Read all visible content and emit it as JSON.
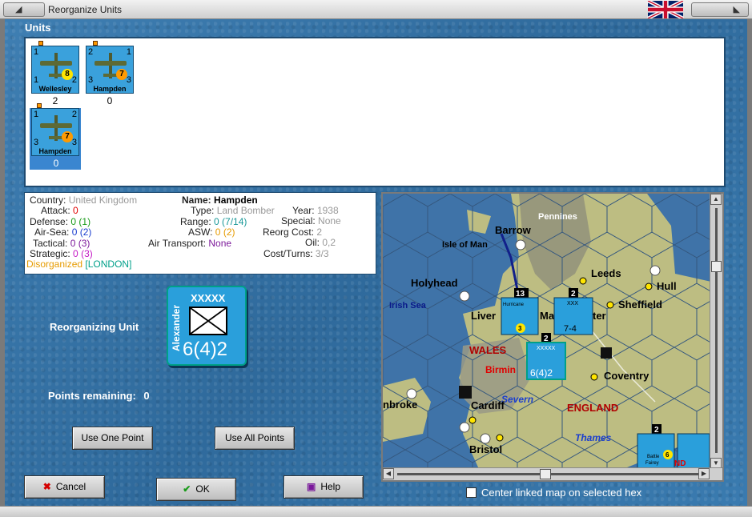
{
  "window": {
    "title": "Reorganize Units"
  },
  "units": {
    "label": "Units",
    "items": [
      {
        "name": "Wellesley",
        "tl": "1",
        "tr": "",
        "bl": "1",
        "br": "2",
        "badge": "8",
        "badge_color": "yellow",
        "count": "2",
        "selected": false
      },
      {
        "name": "Hampden",
        "tl": "2",
        "tr": "1",
        "bl": "3",
        "br": "3",
        "badge": "7",
        "badge_color": "orange",
        "count": "0",
        "selected": false
      },
      {
        "name": "Hampden",
        "tl": "1",
        "tr": "2",
        "bl": "3",
        "br": "3",
        "badge": "7",
        "badge_color": "orange",
        "count": "0",
        "selected": true
      }
    ]
  },
  "info": {
    "country_label": "Country:",
    "country": "United Kingdom",
    "attack_label": "Attack:",
    "attack": "0",
    "defense_label": "Defense:",
    "defense": "0",
    "defense_extra": "(1)",
    "airsea_label": "Air-Sea:",
    "airsea": "0",
    "airsea_extra": "(2)",
    "tactical_label": "Tactical:",
    "tactical": "0",
    "tactical_extra": "(3)",
    "strategic_label": "Strategic:",
    "strategic": "0",
    "strategic_extra": "(3)",
    "status": "Disorganized",
    "location": "[LONDON]",
    "name_label": "Name:",
    "name": "Hampden",
    "type_label": "Type:",
    "type": "Land Bomber",
    "range_label": "Range:",
    "range": "0 (7/14)",
    "asw_label": "ASW:",
    "asw": "0",
    "asw_extra": "(2)",
    "air_transport_label": "Air Transport:",
    "air_transport": "None",
    "year_label": "Year:",
    "year": "1938",
    "special_label": "Special:",
    "special": "None",
    "reorg_cost_label": "Reorg Cost:",
    "reorg_cost": "2",
    "oil_label": "Oil:",
    "oil": "0,2",
    "cost_turns_label": "Cost/Turns:",
    "cost_turns": "3/3"
  },
  "reorg": {
    "label": "Reorganizing Unit",
    "corps": "XXXXX",
    "leader": "Alexander",
    "strength": "6(4)2",
    "points_label": "Points remaining:",
    "points": "0"
  },
  "buttons": {
    "use_one": "Use One Point",
    "use_all": "Use All Points",
    "cancel": "Cancel",
    "ok": "OK",
    "help": "Help"
  },
  "map": {
    "labels": {
      "pennines": "Pennines",
      "barrow": "Barrow",
      "isle_of_man": "Isle of Man",
      "leeds": "Leeds",
      "hull": "Hull",
      "holyhead": "Holyhead",
      "irish_sea": "Irish Sea",
      "sheffield": "Sheffield",
      "liver": "Liver",
      "ma": "Ma",
      "ter": "ter",
      "wales": "WALES",
      "birmin": "Birmin",
      "coventry": "Coventry",
      "severn": "Severn",
      "england": "ENGLAND",
      "nbroke": "nbroke",
      "cardiff": "Cardiff",
      "thames": "Thames",
      "bristol": "Bristol"
    },
    "stacks": {
      "a": "13",
      "b": "2",
      "c": "2",
      "d": "2"
    },
    "counters": {
      "hurricane_badge": "3",
      "hurricane_name": "Hurricane",
      "corps_xxx": "XXX",
      "corps_strength": "7-4",
      "alex_xxxxx": "XXXXX",
      "alex_strength": "6(4)2",
      "battle_name": "Battle",
      "fairey_name": "Fairey",
      "battle_badge": "6",
      "nd": "ND"
    }
  },
  "center_linked_label": "Center linked map on selected hex",
  "colors": {
    "unit_blue": "#3aa1dc",
    "panel_border": "#1e4a70",
    "accent_teal": "#00a088"
  }
}
